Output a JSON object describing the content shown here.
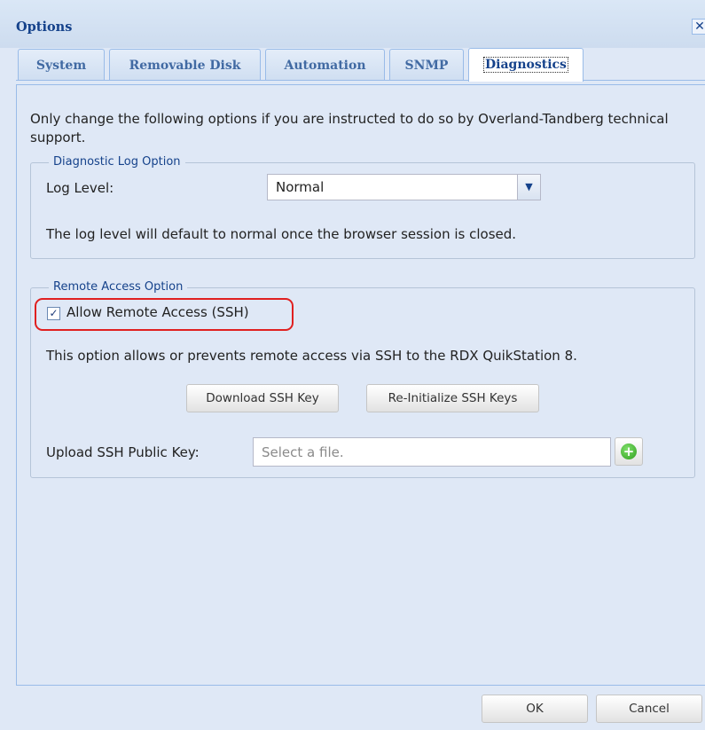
{
  "window": {
    "title": "Options",
    "close_glyph": "✕"
  },
  "tabs": [
    {
      "label": "System",
      "active": false
    },
    {
      "label": "Removable Disk",
      "active": false
    },
    {
      "label": "Automation",
      "active": false
    },
    {
      "label": "SNMP",
      "active": false
    },
    {
      "label": "Diagnostics",
      "active": true
    }
  ],
  "intro_text": "Only change the following options if you are instructed to do so by Overland-Tandberg technical support.",
  "diagnostic_log": {
    "legend": "Diagnostic Log Option",
    "log_level_label": "Log Level:",
    "log_level_value": "Normal",
    "note": "The log level will default to normal once the browser session is closed."
  },
  "remote_access": {
    "legend": "Remote Access Option",
    "checkbox_label": "Allow Remote Access (SSH)",
    "checked": true,
    "note": "This option allows or prevents remote access via SSH to the RDX QuikStation 8.",
    "download_button": "Download SSH Key",
    "reinit_button": "Re-Initialize SSH Keys",
    "upload_label": "Upload SSH Public Key:",
    "upload_placeholder": "Select a file."
  },
  "footer": {
    "ok_label": "OK",
    "cancel_label": "Cancel"
  },
  "icons": {
    "close": "close-icon",
    "dropdown": "chevron-down-icon",
    "checkbox": "checkmark-icon",
    "add": "plus-circle-icon"
  },
  "colors": {
    "highlight": "#e02020",
    "title": "#15428b",
    "panel": "#dfe8f6"
  }
}
